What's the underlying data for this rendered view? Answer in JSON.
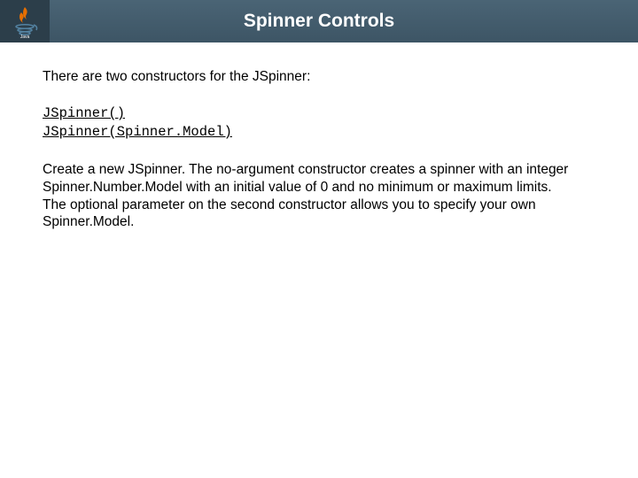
{
  "header": {
    "title": "Spinner Controls",
    "logo_label": "Java"
  },
  "content": {
    "intro": "There are two constructors for the JSpinner:",
    "code_line1": "JSpinner()",
    "code_line2": "JSpinner(Spinner.Model)",
    "description": "Create a new JSpinner. The no-argument constructor creates a spinner with an integer Spinner.Number.Model with an initial value of 0 and no minimum or maximum limits. The optional parameter on the second constructor allows you to specify your own Spinner.Model."
  }
}
